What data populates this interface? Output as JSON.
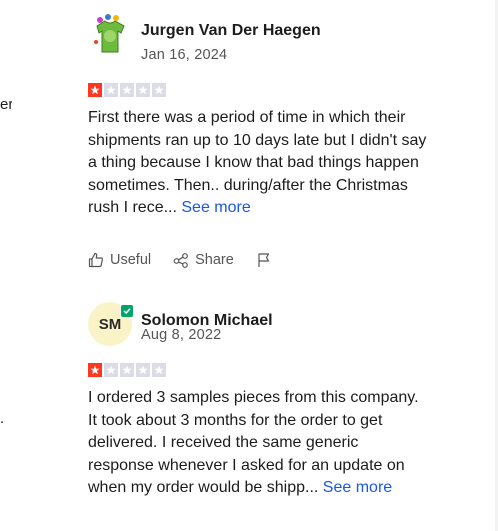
{
  "left_edge": {
    "top_fragment": "er",
    "bottom_fragment": "."
  },
  "reviews": [
    {
      "name": "Jurgen Van Der Haegen",
      "date": "Jan 16, 2024",
      "rating": 1,
      "text": "First there was a period of time in which their shipments ran up to 10 days late but I didn't say a thing because I know that bad things happen sometimes. Then.. during/after the Christmas rush I rece...",
      "see_more": "See more",
      "actions": {
        "useful": "Useful",
        "share": "Share"
      }
    },
    {
      "name": "Solomon Michael",
      "initials": "SM",
      "date": "Aug 8, 2022",
      "rating": 1,
      "text": "I ordered 3 samples pieces from this company. It took about 3 months for the order to get delivered. I received the same generic response whenever I asked for an update on when my order would be shipp...",
      "see_more": "See more"
    }
  ],
  "colors": {
    "star_on": "#ff3722",
    "star_off": "#dcdce6",
    "link": "#1a56e8",
    "verified": "#04a36a"
  }
}
